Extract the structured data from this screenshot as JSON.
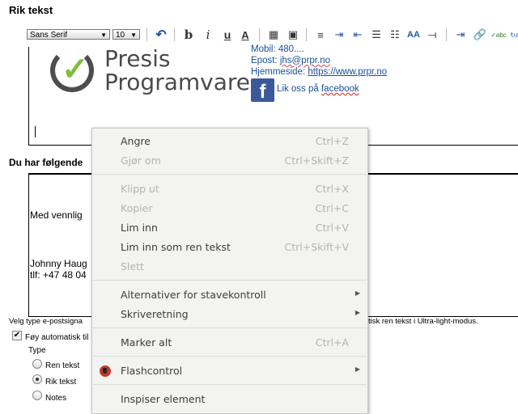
{
  "editor": {
    "title": "Rik tekst",
    "font_family": "Sans Serif",
    "font_size": "10"
  },
  "signature_preview": {
    "logo_line1": "Presis",
    "logo_line2": "Programvare",
    "mobile": "Mobil: 480....",
    "email_label": "Epost: ",
    "email": "jhs@prpr.no",
    "web_label": "Hjemmeside: ",
    "web": "https://www.prpr.no",
    "facebook_text": "Lik oss på ",
    "facebook_link": "facebook"
  },
  "section2": {
    "heading": "Du har følgende",
    "greeting": "Med vennlig",
    "name": "Johnny Haug",
    "phone": "tlf: +47 48 04"
  },
  "settings": {
    "note_left": "Velg type e-postsigna",
    "note_right": "tisk ren tekst i Ultra-light-modus.",
    "auto_add": "Føy automatisk til",
    "type_label": "Type",
    "options": [
      "Ren tekst",
      "Rik tekst",
      "Notes"
    ],
    "selected": "Rik tekst"
  },
  "context_menu": {
    "items": [
      {
        "label": "Angre",
        "shortcut": "Ctrl+Z"
      },
      {
        "label": "Gjør om",
        "shortcut": "Ctrl+Skift+Z"
      },
      {
        "label": "Klipp ut",
        "shortcut": "Ctrl+X"
      },
      {
        "label": "Kopier",
        "shortcut": "Ctrl+C"
      },
      {
        "label": "Lim inn",
        "shortcut": "Ctrl+V"
      },
      {
        "label": "Lim inn som ren tekst",
        "shortcut": "Ctrl+Skift+V"
      },
      {
        "label": "Slett"
      },
      {
        "label": "Alternativer for stavekontroll"
      },
      {
        "label": "Skriveretning"
      },
      {
        "label": "Marker alt",
        "shortcut": "Ctrl+A"
      },
      {
        "label": "Flashcontrol"
      },
      {
        "label": "Inspiser element"
      }
    ]
  }
}
